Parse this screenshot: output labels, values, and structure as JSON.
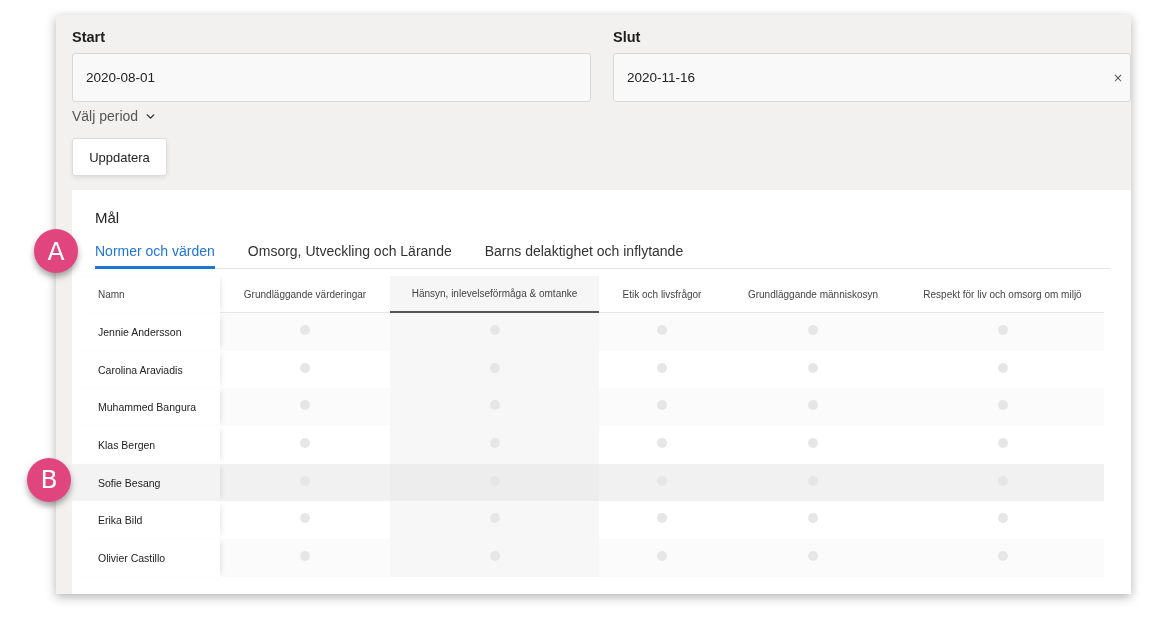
{
  "filters": {
    "start": {
      "label": "Start",
      "value": "2020-08-01"
    },
    "end": {
      "label": "Slut",
      "value": "2020-11-16",
      "clear": "×"
    },
    "period_menu": {
      "label": "Välj period",
      "expanded": false
    },
    "update_button": "Uppdatera"
  },
  "goals": {
    "title": "Mål",
    "tab_callout": "A",
    "tabs": [
      {
        "label": "Normer och värden",
        "selected": true
      },
      {
        "label": "Omsorg, Utveckling och Lärande",
        "selected": false
      },
      {
        "label": "Barns delaktighet och inflytande",
        "selected": false
      }
    ]
  },
  "table": {
    "name_header": "Namn",
    "columns": [
      {
        "label": "Grundläggande värderingar",
        "selected": false
      },
      {
        "label": "Hänsyn, inlevelseförmåga & omtanke",
        "selected": true
      },
      {
        "label": "Etik och livsfrågor",
        "selected": false
      },
      {
        "label": "Grundläggande människosyn",
        "selected": false
      },
      {
        "label": "Respekt för liv och omsorg om miljö",
        "selected": false
      }
    ],
    "rows": [
      {
        "name": "Jennie Andersson",
        "selected": false
      },
      {
        "name": "Carolina Araviadis",
        "selected": false
      },
      {
        "name": "Muhammed Bangura",
        "selected": false
      },
      {
        "name": "Klas Bergen",
        "selected": false
      },
      {
        "name": "Sofie Besang",
        "selected": true,
        "callout": "B"
      },
      {
        "name": "Erika Bild",
        "selected": false
      },
      {
        "name": "Olivier Castillo",
        "selected": false
      }
    ]
  }
}
